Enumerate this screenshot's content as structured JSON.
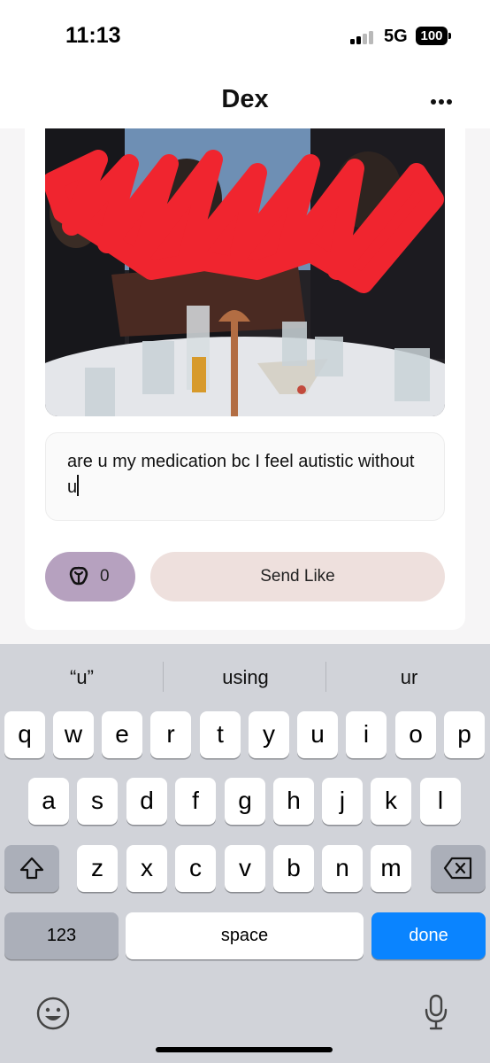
{
  "status_bar": {
    "time": "11:13",
    "network": "5G",
    "battery": "100"
  },
  "header": {
    "title": "Dex",
    "more_icon": "more-horizontal-icon"
  },
  "profile_photo": {
    "description_icon": "photo",
    "scribble_color": "#f0252f"
  },
  "comment": {
    "value": "are u my medication bc I feel autistic without u"
  },
  "actions": {
    "rose_icon": "rose-icon",
    "rose_count": "0",
    "send_like_label": "Send Like"
  },
  "keyboard": {
    "suggestions": [
      "“u”",
      "using",
      "ur"
    ],
    "row1": [
      "q",
      "w",
      "e",
      "r",
      "t",
      "y",
      "u",
      "i",
      "o",
      "p"
    ],
    "row2": [
      "a",
      "s",
      "d",
      "f",
      "g",
      "h",
      "j",
      "k",
      "l"
    ],
    "row3": [
      "z",
      "x",
      "c",
      "v",
      "b",
      "n",
      "m"
    ],
    "numbers_label": "123",
    "space_label": "space",
    "done_label": "done",
    "shift_icon": "shift-icon",
    "delete_icon": "delete-icon",
    "emoji_icon": "emoji-icon",
    "mic_icon": "microphone-icon"
  },
  "colors": {
    "accent_blue": "#0a84ff",
    "rose_button": "#b6a1bf",
    "send_like_button": "#eee0dd"
  }
}
